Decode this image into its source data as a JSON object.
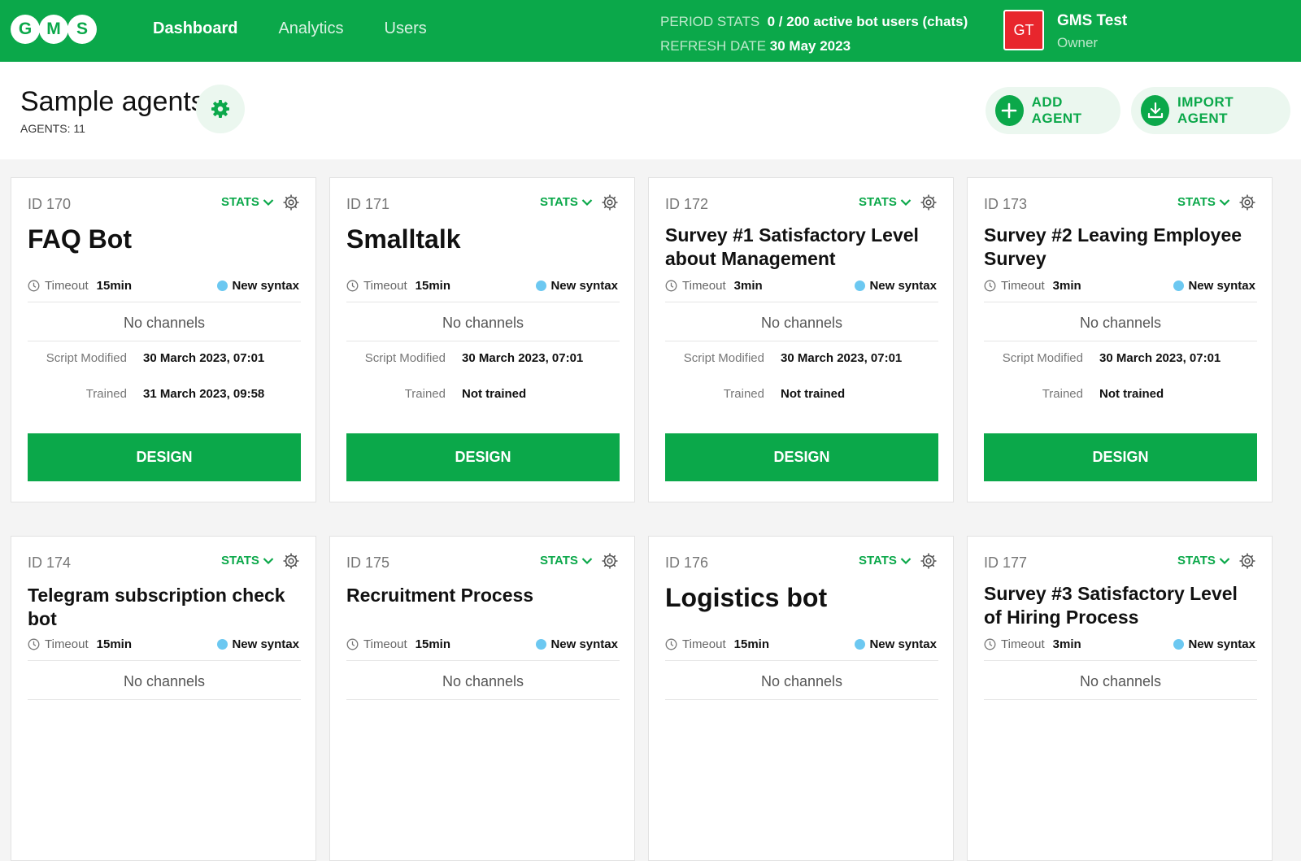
{
  "topbar": {
    "logo_letters": [
      "G",
      "M",
      "S"
    ],
    "nav": [
      {
        "label": "Dashboard",
        "active": true
      },
      {
        "label": "Analytics",
        "active": false
      },
      {
        "label": "Users",
        "active": false
      }
    ],
    "period_stats_label": "PERIOD STATS",
    "period_stats_value": "0  / 200 active bot users (chats)",
    "refresh_label": "REFRESH DATE",
    "refresh_value": "30 May 2023",
    "avatar_initials": "GT",
    "user_name": "GMS Test",
    "user_role": "Owner"
  },
  "header": {
    "title": "Sample agents",
    "agents_count": "AGENTS: 11",
    "add_agent_label": "ADD AGENT",
    "import_agent_label": "IMPORT AGENT"
  },
  "card_labels": {
    "stats": "STATS",
    "timeout": "Timeout",
    "syntax": "New syntax",
    "channels": "No channels",
    "script_modified": "Script Modified",
    "trained": "Trained",
    "design": "DESIGN"
  },
  "cards": [
    {
      "id": "ID 170",
      "title": "FAQ Bot",
      "timeout": "15min",
      "script_modified": "30 March 2023, 07:01",
      "trained": "31 March 2023, 09:58"
    },
    {
      "id": "ID 171",
      "title": "Smalltalk",
      "timeout": "15min",
      "script_modified": "30 March 2023, 07:01",
      "trained": "Not trained"
    },
    {
      "id": "ID 172",
      "title": "Survey #1 Satisfactory Level about Management",
      "timeout": "3min",
      "script_modified": "30 March 2023, 07:01",
      "trained": "Not trained"
    },
    {
      "id": "ID 173",
      "title": "Survey #2 Leaving Employee Survey",
      "timeout": "3min",
      "script_modified": "30 March 2023, 07:01",
      "trained": "Not trained"
    },
    {
      "id": "ID 174",
      "title": "Telegram subscription check bot",
      "timeout": "15min"
    },
    {
      "id": "ID 175",
      "title": "Recruitment Process",
      "timeout": "15min"
    },
    {
      "id": "ID 176",
      "title": "Logistics bot",
      "timeout": "15min"
    },
    {
      "id": "ID 177",
      "title": "Survey #3 Satisfactory Level of Hiring Process",
      "timeout": "3min"
    }
  ],
  "colors": {
    "brand_green": "#0ba84a",
    "avatar_red": "#e8262d",
    "syntax_dot": "#6cc8f1"
  }
}
